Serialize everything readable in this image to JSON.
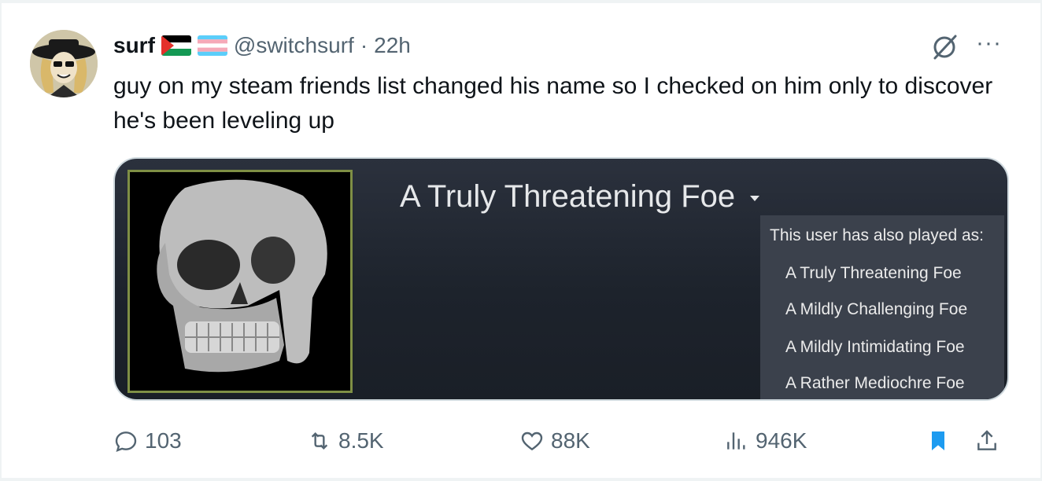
{
  "tweet": {
    "display_name": "surf",
    "handle": "@switchsurf",
    "separator": "·",
    "time": "22h",
    "more_label": "···",
    "text": "guy on my steam friends list changed his name so I checked on him only to discover he's been leveling up"
  },
  "media": {
    "profile_name": "A Truly Threatening Foe",
    "alias_title": "This user has also played as:",
    "aliases": [
      "A Truly Threatening Foe",
      "A Mildly Challenging Foe",
      "A Mildly Intimidating Foe",
      "A Rather Mediochre Foe"
    ]
  },
  "actions": {
    "replies": "103",
    "reposts": "8.5K",
    "likes": "88K",
    "views": "946K"
  },
  "colors": {
    "accent": "#1d9bf0",
    "muted": "#536471",
    "steam_bg": "#1d232c",
    "steam_frame": "#7f8f45"
  },
  "icons": [
    "avatar-illustration",
    "palestine-flag",
    "transgender-flag",
    "grok-icon",
    "more-icon",
    "reply-icon",
    "repost-icon",
    "like-icon",
    "views-icon",
    "bookmark-icon",
    "share-icon"
  ]
}
